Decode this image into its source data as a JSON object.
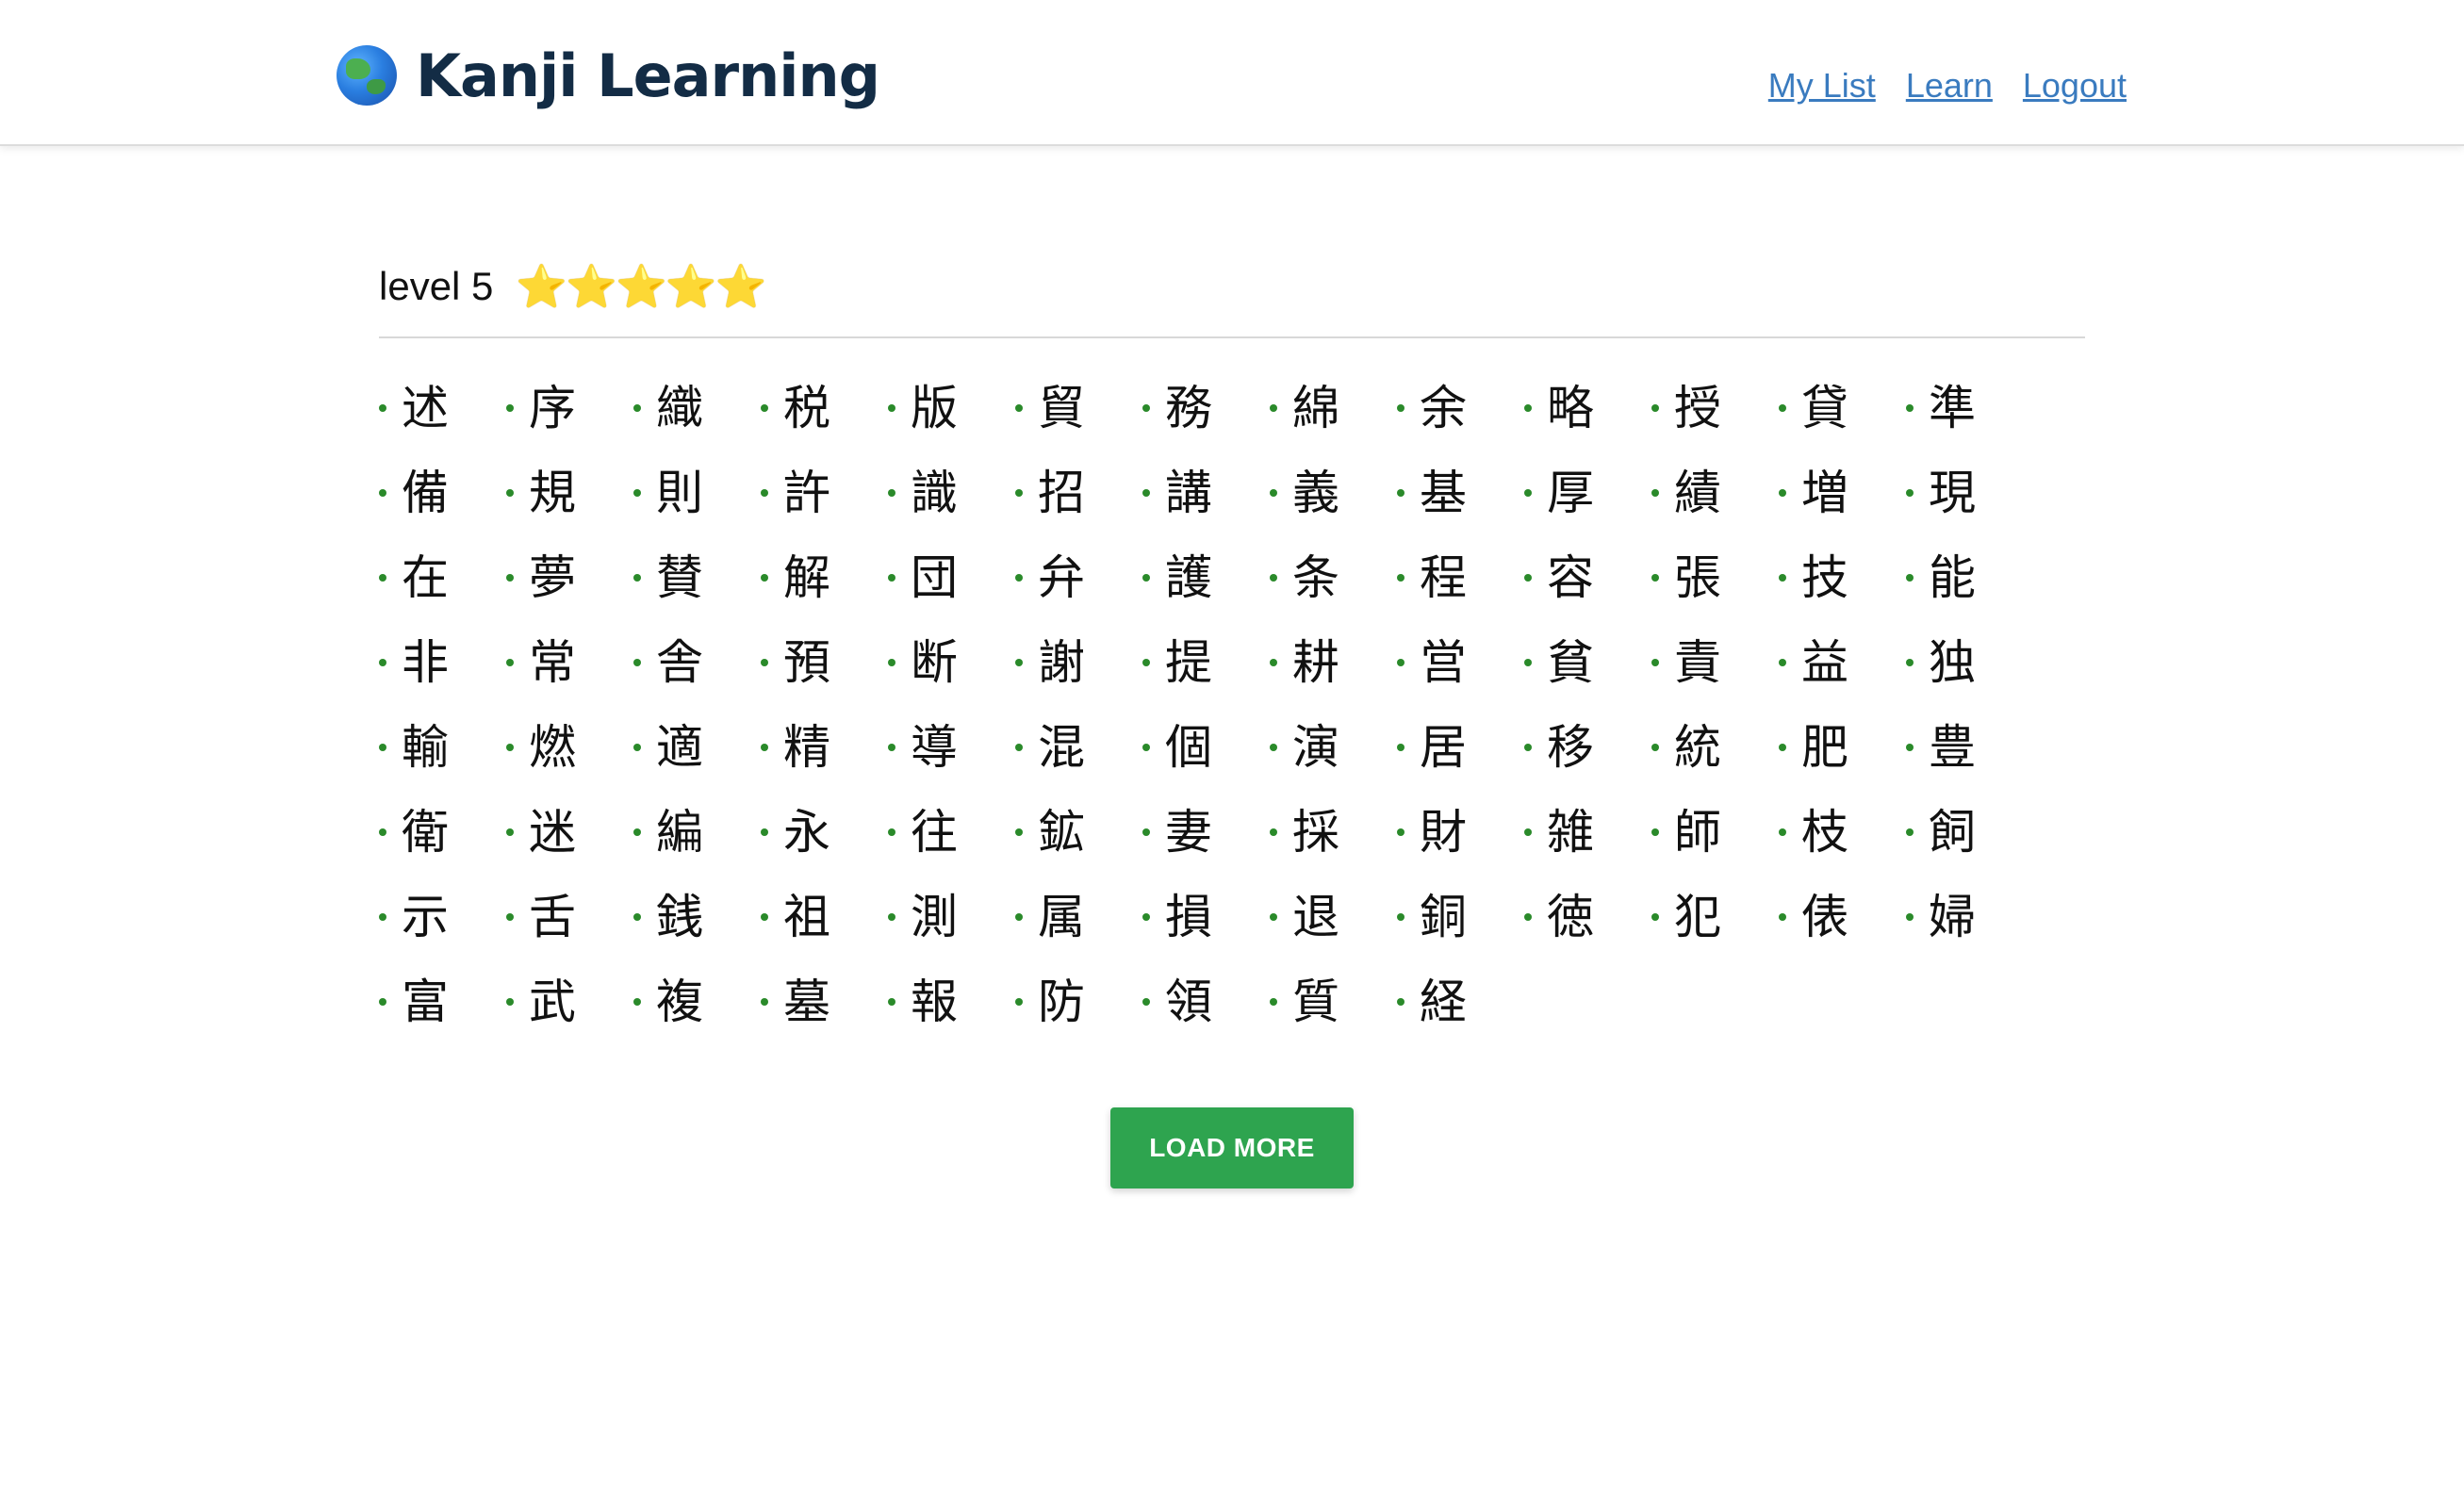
{
  "header": {
    "logo_text": "Kanji Learning",
    "logo_icon": "globe-asia-icon",
    "nav": [
      {
        "label": "My List"
      },
      {
        "label": "Learn"
      },
      {
        "label": "Logout"
      }
    ]
  },
  "level": {
    "label": "level 5",
    "stars": "⭐⭐⭐⭐⭐",
    "star_count": 5
  },
  "kanji_list": [
    "述",
    "序",
    "織",
    "税",
    "版",
    "貿",
    "務",
    "綿",
    "余",
    "略",
    "授",
    "貸",
    "準",
    "備",
    "規",
    "則",
    "許",
    "識",
    "招",
    "講",
    "義",
    "基",
    "厚",
    "績",
    "増",
    "現",
    "在",
    "夢",
    "賛",
    "解",
    "団",
    "弁",
    "護",
    "条",
    "程",
    "容",
    "張",
    "技",
    "能",
    "非",
    "常",
    "舎",
    "預",
    "断",
    "謝",
    "提",
    "耕",
    "営",
    "貧",
    "責",
    "益",
    "独",
    "輸",
    "燃",
    "適",
    "精",
    "導",
    "混",
    "個",
    "演",
    "居",
    "移",
    "統",
    "肥",
    "豊",
    "衛",
    "迷",
    "編",
    "永",
    "往",
    "鉱",
    "妻",
    "採",
    "財",
    "雑",
    "師",
    "枝",
    "飼",
    "示",
    "舌",
    "銭",
    "祖",
    "測",
    "属",
    "損",
    "退",
    "銅",
    "徳",
    "犯",
    "俵",
    "婦",
    "富",
    "武",
    "複",
    "墓",
    "報",
    "防",
    "領",
    "質",
    "経"
  ],
  "actions": {
    "load_more_label": "LOAD MORE"
  },
  "colors": {
    "accent_green": "#2ea44f",
    "bullet_green": "#2a8a2a",
    "link_blue": "#3a7bbf",
    "logo_navy": "#132c45"
  }
}
